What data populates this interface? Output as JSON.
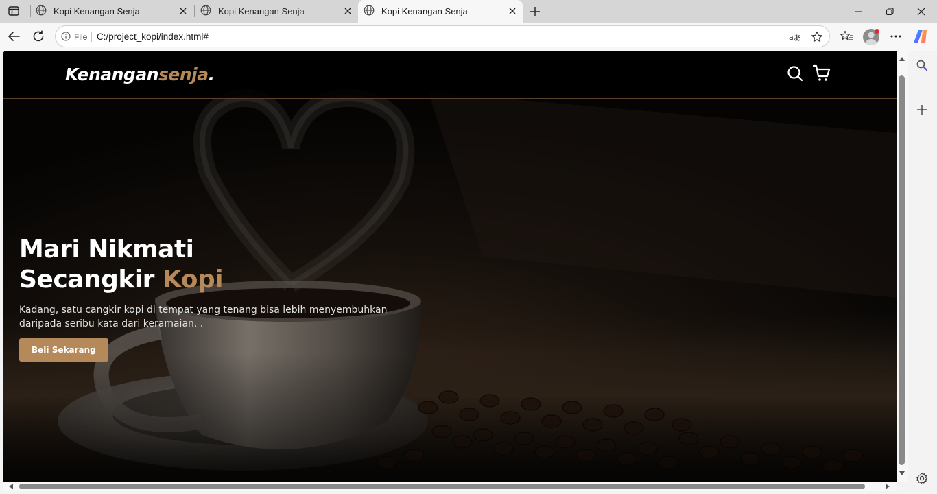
{
  "browser": {
    "tabs": [
      {
        "title": "Kopi Kenangan Senja",
        "active": false
      },
      {
        "title": "Kopi Kenangan Senja",
        "active": false
      },
      {
        "title": "Kopi Kenangan Senja",
        "active": true
      }
    ],
    "address": {
      "scheme_label": "File",
      "url": "C:/project_kopi/index.html#"
    }
  },
  "site": {
    "logo_main": "Kenangan",
    "logo_accent": "senja",
    "logo_dot": ".",
    "hero": {
      "title_line1": "Mari Nikmati",
      "title_line2_plain": "Secangkir ",
      "title_line2_accent": "Kopi",
      "description": "Kadang, satu cangkir kopi di tempat yang tenang bisa lebih menyembuhkan daripada seribu kata dari keramaian. .",
      "cta_label": "Beli Sekarang"
    }
  },
  "colors": {
    "accent": "#b6895b",
    "nav_bg": "#0c0a08",
    "tabstrip_bg": "#d6d6d6",
    "toolbar_bg": "#f7f7f7"
  },
  "icons": [
    "sidebar-toggle-icon",
    "globe-icon",
    "close-icon",
    "plus-icon",
    "minimize-icon",
    "restore-icon",
    "back-icon",
    "refresh-icon",
    "info-icon",
    "read-aloud-icon",
    "star-icon",
    "favorites-icon",
    "profile-icon",
    "more-icon",
    "copilot-icon",
    "search-icon",
    "cart-icon",
    "settings-icon"
  ]
}
